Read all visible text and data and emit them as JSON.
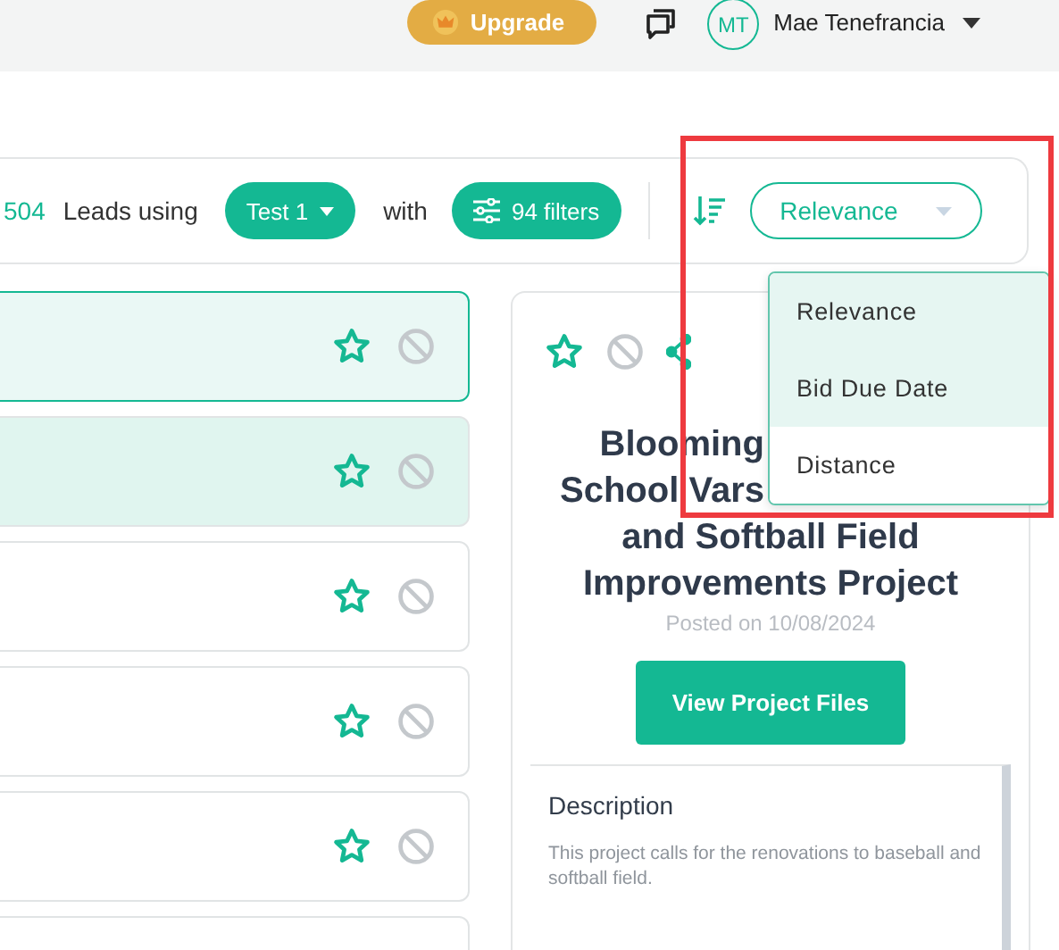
{
  "header": {
    "upgrade": "Upgrade",
    "avatar": "MT",
    "user_name": "Mae Tenefrancia"
  },
  "toolbar": {
    "count": "504",
    "count_label": "Leads using",
    "preset": "Test 1",
    "with_label": "with",
    "filters": "94 filters",
    "sort_value": "Relevance"
  },
  "sort_menu": [
    {
      "label": "Relevance",
      "highlighted": true
    },
    {
      "label": "Bid Due Date",
      "highlighted": true
    },
    {
      "label": "Distance",
      "highlighted": false
    }
  ],
  "leads": [
    {
      "selected": true,
      "highlighted": false
    },
    {
      "selected": false,
      "highlighted": true
    },
    {
      "selected": false,
      "highlighted": false
    },
    {
      "selected": false,
      "highlighted": false
    },
    {
      "selected": false,
      "highlighted": false
    },
    {
      "selected": false,
      "highlighted": false,
      "cut": true
    }
  ],
  "detail": {
    "title_lines": [
      {
        "text": "Blooming",
        "cut": true
      },
      {
        "text": "School Vars",
        "cut": true
      },
      {
        "text": "and Softball Field",
        "cut": false
      },
      {
        "text": "Improvements Project",
        "cut": false
      }
    ],
    "posted": "Posted on 10/08/2024",
    "button": "View Project Files",
    "description_heading": "Description",
    "description": "This project calls for the renovations to baseball and softball field."
  }
}
